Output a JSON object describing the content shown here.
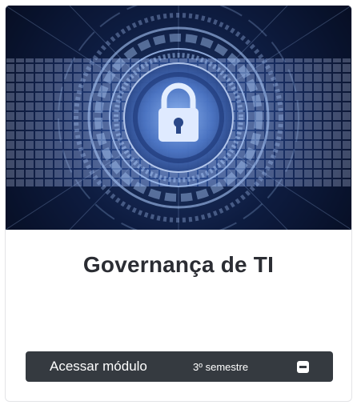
{
  "card": {
    "title": "Governança de TI",
    "image_icon": "padlock-icon",
    "access_label": "Acessar módulo",
    "semester": "3º semestre",
    "toggle_icon": "minus-square-icon"
  },
  "colors": {
    "bar_background": "#353a40",
    "title_text": "#2b2d33",
    "image_dark": "#0b1530",
    "image_glow": "#7fb4ff"
  }
}
